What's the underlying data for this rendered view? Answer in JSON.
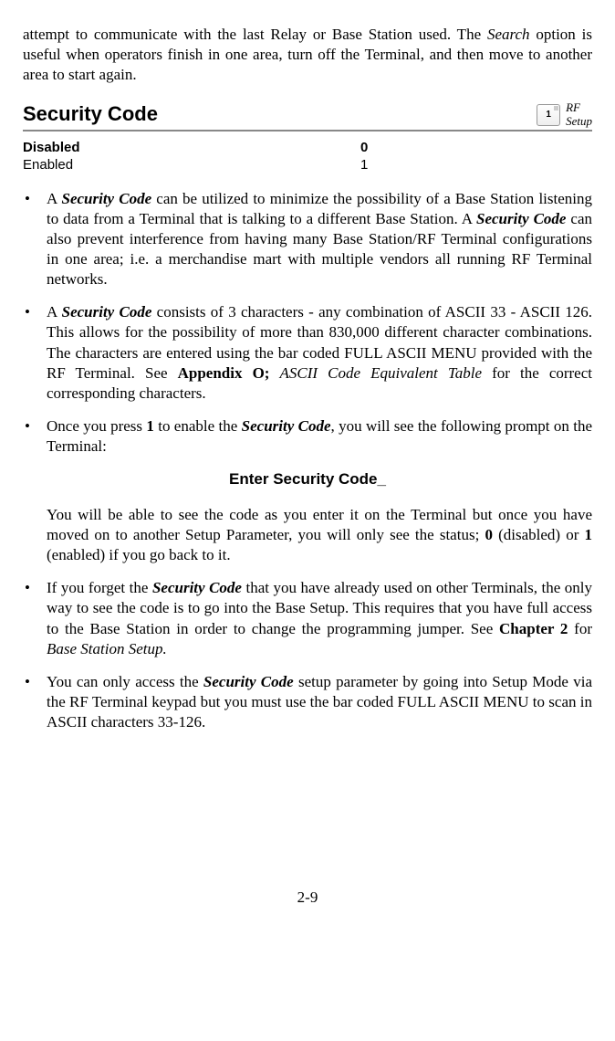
{
  "intro": {
    "pre": "attempt to communicate with the last Relay or Base Station used. The ",
    "search": "Search",
    "post": " option is useful when operators finish in one area, turn off the Terminal, and then move to another area to start again."
  },
  "heading": "Security Code",
  "rf": {
    "key": "1",
    "line1": "RF",
    "line2": "Setup"
  },
  "options": {
    "row0": {
      "label": "Disabled",
      "value": "0"
    },
    "row1": {
      "label": "Enabled",
      "value": "1"
    }
  },
  "b1": {
    "t1": "A ",
    "sc1": "Security Code",
    "t2": " can be utilized to minimize the possibility of a Base Station listening to data from a Terminal that is talking to a different Base Station.  A ",
    "sc2": "Security Code",
    "t3": " can also prevent interference from having many Base Station/RF Terminal configurations in one area; i.e. a merchandise mart with multiple vendors all running RF Terminal networks."
  },
  "b2": {
    "t1": "A ",
    "sc": "Security Code",
    "t2": " consists of 3 characters - any combination of ASCII 33 - ASCII 126. This allows for the possibility of more than 830,000 different character combinations.  The characters are entered using the bar coded FULL ASCII MENU provided with the RF Terminal. See ",
    "apx": "Appendix O;",
    "t3": " ",
    "ital": "ASCII Code Equivalent Table",
    "t4": " for the correct corresponding characters."
  },
  "b3": {
    "t1": "Once you press ",
    "one": "1",
    "t2": " to enable the ",
    "sc": "Security Code",
    "t3": ", you will see the following prompt on the Terminal:"
  },
  "prompt": "Enter Security Code_",
  "b3b": {
    "t1": "You will be able to see the code as you enter it on the Terminal but once you have moved on to another Setup Parameter, you will only see the status; ",
    "zero": "0",
    "t2": " (disabled) or ",
    "one": "1",
    "t3": " (enabled) if you go back to it."
  },
  "b4": {
    "t1": "If you forget the ",
    "sc": "Security Code",
    "t2": " that you have already used on other Terminals, the only way to see the code is to go into the Base Setup. This requires that you have full access to the Base Station in order to change the programming jumper.  See ",
    "ch": "Chapter 2",
    "t3": " for ",
    "ital": "Base Station Setup.",
    "t4": ""
  },
  "b5": {
    "t1": "You can only access the ",
    "sc": "Security Code",
    "t2": " setup parameter by going into Setup Mode via the RF Terminal keypad but you must use the bar coded FULL ASCII MENU to scan in ASCII characters 33-126."
  },
  "page": "2-9"
}
